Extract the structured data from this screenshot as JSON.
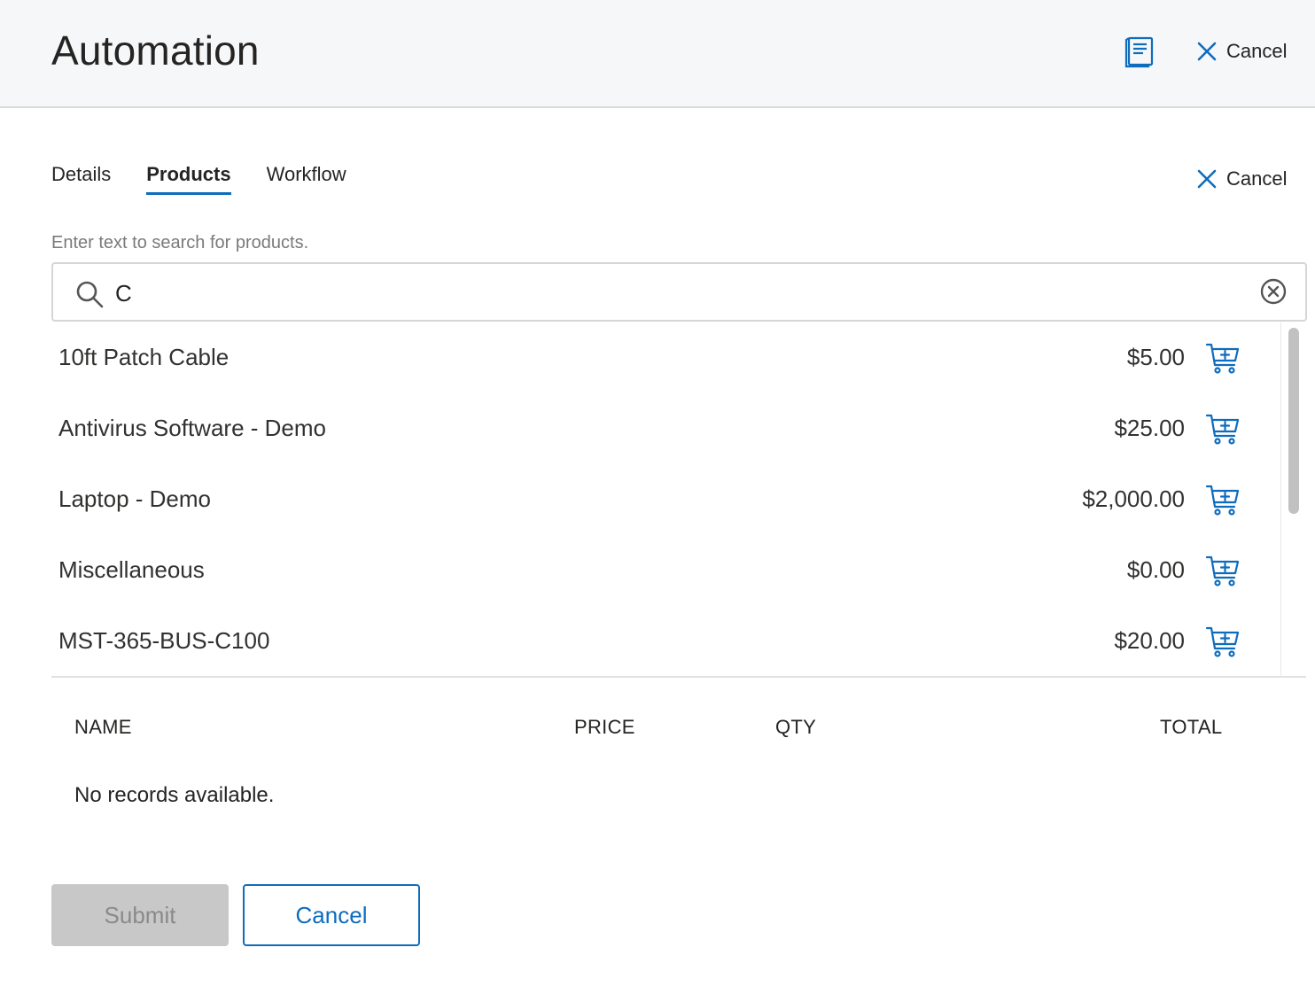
{
  "header": {
    "title": "Automation",
    "cancel_label": "Cancel"
  },
  "tabs": [
    {
      "label": "Details",
      "active": false
    },
    {
      "label": "Products",
      "active": true
    },
    {
      "label": "Workflow",
      "active": false
    }
  ],
  "body_cancel_label": "Cancel",
  "search": {
    "label": "Enter text to search for products.",
    "value": "C"
  },
  "results": [
    {
      "name": "10ft Patch Cable",
      "price": "$5.00"
    },
    {
      "name": "Antivirus Software - Demo",
      "price": "$25.00"
    },
    {
      "name": "Laptop - Demo",
      "price": "$2,000.00"
    },
    {
      "name": "Miscellaneous",
      "price": "$0.00"
    },
    {
      "name": "MST-365-BUS-C100",
      "price": "$20.00"
    }
  ],
  "table": {
    "columns": [
      "NAME",
      "PRICE",
      "QTY",
      "TOTAL"
    ],
    "empty_message": "No records available."
  },
  "buttons": {
    "submit_label": "Submit",
    "cancel_label": "Cancel"
  },
  "colors": {
    "accent": "#0f6cbd",
    "header_bg": "#f6f7f8",
    "disabled_bg": "#c8c8c8"
  },
  "icons": [
    "book-icon",
    "close-icon",
    "search-icon",
    "clear-icon",
    "cart-add-icon"
  ]
}
